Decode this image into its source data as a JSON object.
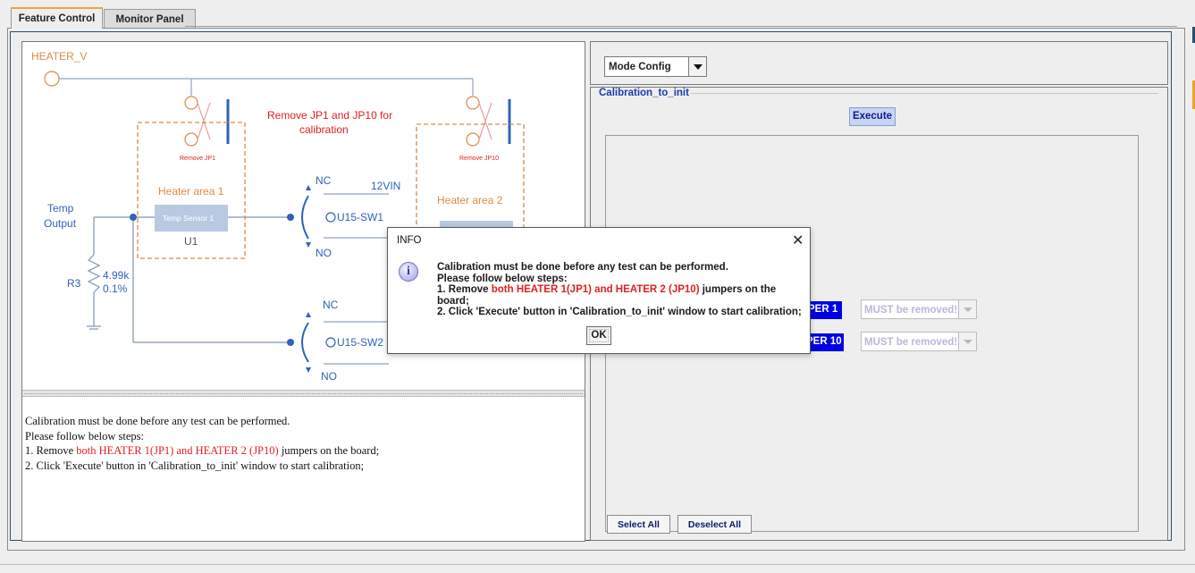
{
  "tabs": [
    {
      "label": "Feature Control",
      "active": true
    },
    {
      "label": "Monitor Panel",
      "active": false
    }
  ],
  "diagram": {
    "heater_v": "HEATER_V",
    "remove_note_line1": "Remove JP1 and JP10 for",
    "remove_note_line2": "calibration",
    "remove_jp1": "Remove JP1",
    "remove_jp10": "Remove JP10",
    "heater_area_1": "Heater area 1",
    "heater_area_2": "Heater area 2",
    "temp_sensor": "Temp Sensor 1",
    "u1": "U1",
    "temp": "Temp",
    "output": "Output",
    "r3": "R3",
    "r_value": "4.99k",
    "r_tol": "0.1%",
    "nc1": "NC",
    "no1": "NO",
    "vin": "12VIN",
    "sw1": "U15-SW1",
    "nc2": "NC",
    "no2": "NO",
    "sw2": "U15-SW2"
  },
  "notes": {
    "line1": "Calibration must be done before any test can be performed.",
    "line2": "Please follow below steps:",
    "line3_pre": "1. Remove ",
    "line3_red": "both HEATER 1(JP1) and HEATER 2 (JP10)",
    "line3_post": " jumpers on the board;",
    "line4": "2. Click 'Execute' button in 'Calibration_to_init' window to start calibration;"
  },
  "mode": {
    "selected": "Mode Config"
  },
  "calibration": {
    "group_title": "Calibration_to_init",
    "execute_label": "Execute",
    "jumpers": [
      {
        "label": "PER 1",
        "value": "MUST be removed!"
      },
      {
        "label": "PER 10",
        "value": "MUST be removed!"
      }
    ],
    "select_all": "Select All",
    "deselect_all": "Deselect All"
  },
  "dialog": {
    "title": "INFO",
    "close": "✕",
    "icon": "i",
    "line1": "Calibration must be done before any test can be performed.",
    "line2": "Please follow below steps:",
    "line3_pre": "1. Remove ",
    "line3_red": "both HEATER 1(JP1) and HEATER 2 (JP10)",
    "line3_post": " jumpers on the board;",
    "line4": "2. Click 'Execute' button in 'Calibration_to_init' window to start calibration;",
    "ok_label": "OK"
  },
  "colors": {
    "accent_blue": "#0000e6",
    "red_text": "#e02020",
    "circuit_blue": "#2f63b8",
    "heater_orange": "#d98c4a"
  }
}
